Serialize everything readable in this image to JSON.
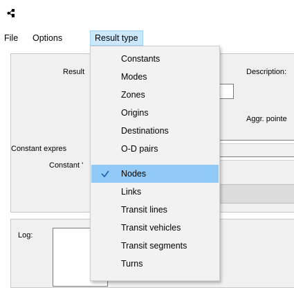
{
  "menubar": {
    "items": [
      "File",
      "Options",
      "Result type"
    ],
    "active_index": 2
  },
  "form": {
    "result_label": "Result",
    "description_label": "Description:",
    "aggr_pointer_label": "Aggr. pointe",
    "constant_expression_label": "Constant expres",
    "constant_label": "Constant '",
    "log_label": "Log:"
  },
  "dropdown": {
    "items": [
      {
        "label": "Constants",
        "checked": false
      },
      {
        "label": "Modes",
        "checked": false
      },
      {
        "label": "Zones",
        "checked": false
      },
      {
        "label": "Origins",
        "checked": false
      },
      {
        "label": "Destinations",
        "checked": false
      },
      {
        "label": "O-D pairs",
        "checked": false
      },
      {
        "label": "Nodes",
        "checked": true
      },
      {
        "label": "Links",
        "checked": false
      },
      {
        "label": "Transit lines",
        "checked": false
      },
      {
        "label": "Transit vehicles",
        "checked": false
      },
      {
        "label": "Transit segments",
        "checked": false
      },
      {
        "label": "Turns",
        "checked": false
      }
    ]
  },
  "icons": {
    "app": "network-icon",
    "check": "check-icon"
  },
  "colors": {
    "selected_item": "#91c9f7",
    "menu_active": "#cce8ff",
    "check": "#1a5fa8",
    "accent_orange": "#e8a020"
  }
}
